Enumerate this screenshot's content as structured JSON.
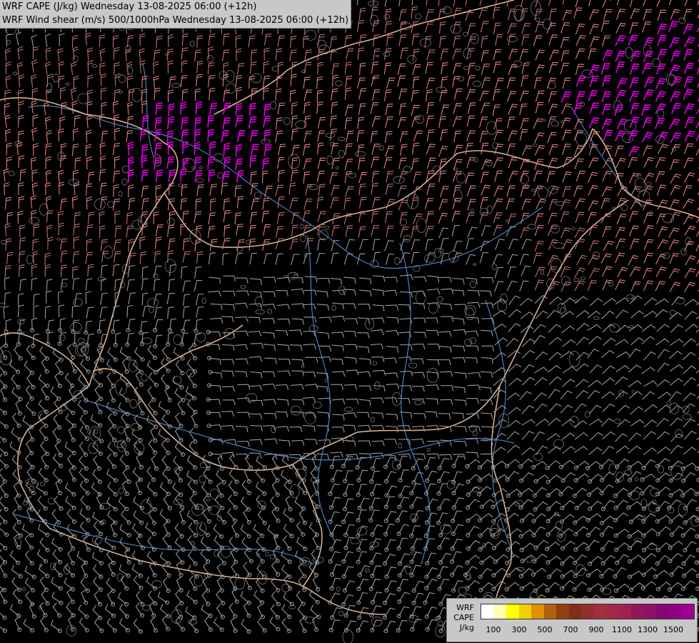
{
  "header": {
    "line1": "WRF CAPE (J/kg) Wednesday 13-08-2025 06:00 (+12h)",
    "line2": "WRF Wind shear (m/s) 500/1000hPa Wednesday 13-08-2025 06:00 (+12h)"
  },
  "legend": {
    "label_line1": "WRF",
    "label_line2": "CAPE",
    "label_line3": "J/kg",
    "colors": [
      "#ffffff",
      "#ffffb0",
      "#ffff00",
      "#f0d000",
      "#e09000",
      "#b06010",
      "#904010",
      "#803018",
      "#903030",
      "#a03040",
      "#a02848",
      "#a02050",
      "#901858",
      "#901068",
      "#800870",
      "#900080",
      "#a00090"
    ],
    "ticks": [
      "100",
      "300",
      "500",
      "700",
      "900",
      "1100",
      "1300",
      "1500"
    ]
  },
  "map": {
    "background": "#000000",
    "border_color": "#d8b090",
    "river_color": "#4a7fc0",
    "contour_color": "#8a8a8a",
    "barb_colors": {
      "weak": "#9a9a9a",
      "moderate": "#c07070",
      "strong": "#e08080",
      "very_strong": "#e000e0"
    }
  }
}
